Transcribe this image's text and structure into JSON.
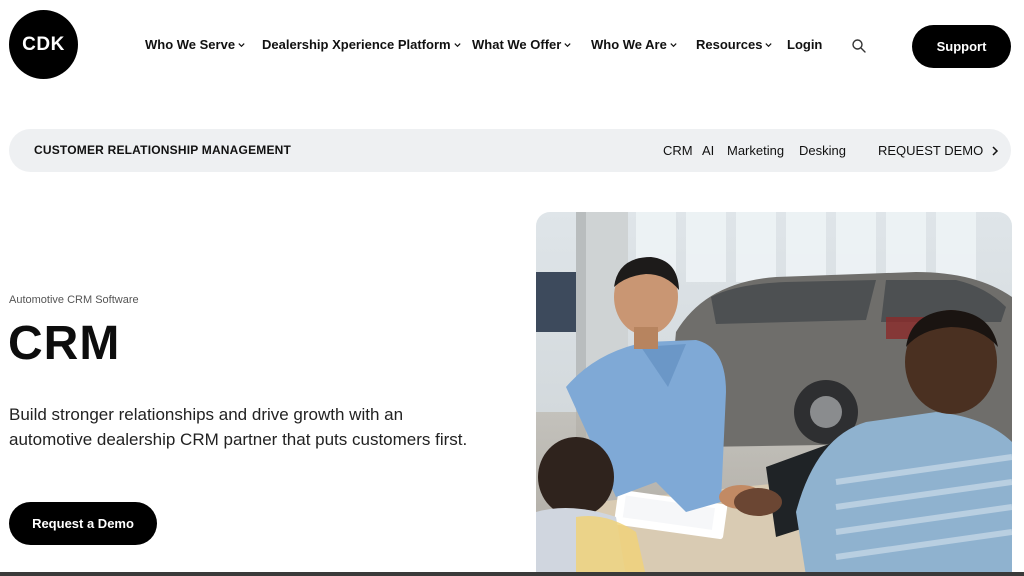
{
  "brand": {
    "logo_text": "CDK"
  },
  "nav": {
    "items": [
      {
        "label": "Who We Serve",
        "has_dropdown": true
      },
      {
        "label": "Dealership Xperience Platform",
        "has_dropdown": true
      },
      {
        "label": "What We Offer",
        "has_dropdown": true
      },
      {
        "label": "Who We Are",
        "has_dropdown": true
      },
      {
        "label": "Resources",
        "has_dropdown": true
      },
      {
        "label": "Login",
        "has_dropdown": false
      }
    ],
    "search_icon": "search-icon",
    "support_label": "Support"
  },
  "subnav": {
    "title": "CUSTOMER RELATIONSHIP MANAGEMENT",
    "links": [
      "CRM",
      "AI",
      "Marketing",
      "Desking"
    ],
    "cta_label": "REQUEST DEMO"
  },
  "hero": {
    "eyebrow": "Automotive CRM Software",
    "title": "CRM",
    "description": "Build stronger relationships and drive growth with an automotive dealership CRM partner that puts customers first.",
    "cta_label": "Request a Demo"
  },
  "colors": {
    "primary": "#000000",
    "subnav_bg": "#eef0f2",
    "text": "#111111",
    "shirt_blue": "#7fa9d6"
  }
}
